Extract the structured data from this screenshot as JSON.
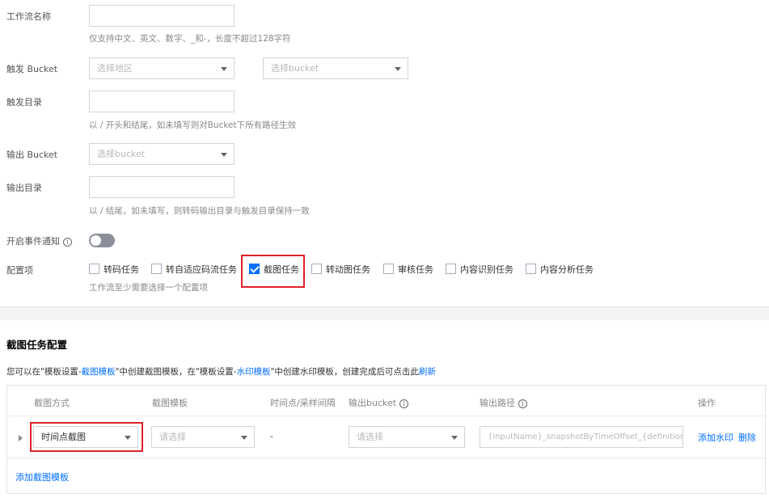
{
  "form": {
    "workflow_name_label": "工作流名称",
    "workflow_name_value": "",
    "workflow_name_hint": "仅支持中文、英文、数字、_和-，长度不超过128字符",
    "trigger_bucket_label": "触发 Bucket",
    "region_placeholder": "选择地区",
    "bucket_placeholder": "选择bucket",
    "trigger_dir_label": "触发目录",
    "trigger_dir_value": "",
    "trigger_dir_hint": "以 / 开头和结尾，如未填写则对Bucket下所有路径生效",
    "output_bucket_label": "输出 Bucket",
    "output_bucket_placeholder": "选择bucket",
    "output_dir_label": "输出目录",
    "output_dir_value": "",
    "output_dir_hint": "以 / 结尾，如未填写，则转码输出目录与触发目录保持一致",
    "event_notify_label": "开启事件通知",
    "event_notify_info": "i",
    "event_notify_on": false,
    "config_label": "配置项",
    "config_hint": "工作流至少需要选择一个配置项",
    "config_items": [
      {
        "label": "转码任务",
        "checked": false
      },
      {
        "label": "转自适应码流任务",
        "checked": false
      },
      {
        "label": "截图任务",
        "checked": true
      },
      {
        "label": "转动图任务",
        "checked": false
      },
      {
        "label": "审核任务",
        "checked": false
      },
      {
        "label": "内容识别任务",
        "checked": false
      },
      {
        "label": "内容分析任务",
        "checked": false
      }
    ]
  },
  "snapshot_config": {
    "title": "截图任务配置",
    "desc_part1": "您可以在\"模板设置-",
    "desc_link1": "截图模板",
    "desc_part2": "\"中创建截图模板，在\"模板设置-",
    "desc_link2": "水印模板",
    "desc_part3": "\"中创建水印模板，创建完成后可点击此",
    "desc_link3": "刷新",
    "table": {
      "headers": [
        "截图方式",
        "截图模板",
        "时间点/采样间隔",
        "输出bucket",
        "输出路径",
        "操作"
      ],
      "info_glyph": "i",
      "row": {
        "mode_value": "时间点截图",
        "template_placeholder": "请选择",
        "interval_value": "-",
        "bucket_placeholder": "请选择",
        "path_placeholder": "{inputName}_snapshotByTimeOffset_{definition}_",
        "action_watermark": "添加水印",
        "action_delete": "删除"
      },
      "add_template": "添加截图模板"
    }
  },
  "colors": {
    "accent": "#006eff",
    "highlight": "#e0202a"
  }
}
